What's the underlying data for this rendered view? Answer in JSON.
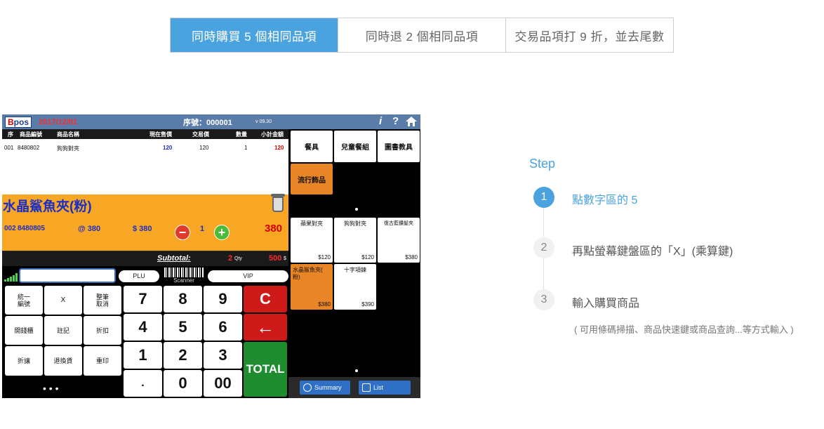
{
  "tabs": [
    {
      "label": "同時購買 5 個相同品項",
      "active": true
    },
    {
      "label": "同時退 2 個相同品項",
      "active": false
    },
    {
      "label": "交易品項打 9 折，並去尾數",
      "active": false
    }
  ],
  "pos": {
    "logo_b": "B",
    "logo_rest": "pos",
    "date": "2017/12/01",
    "seq": "序號：000001",
    "version": "v 09.30",
    "icons": {
      "info": "i",
      "help": "?",
      "home": "home-icon"
    },
    "headers": {
      "no": "序",
      "code": "商品編號",
      "name": "商品名稱",
      "price": "現在售價",
      "deal": "交易價",
      "qty": "數量",
      "subtotal": "小計金額"
    },
    "row": {
      "no": "001",
      "code": "8480802",
      "name": "狗狗對夾",
      "price": "120",
      "deal": "120",
      "qty": "1",
      "subtotal": "120"
    },
    "current": {
      "name": "水晶鯊魚夾(粉)",
      "seq": "002",
      "code": "8480805",
      "at": "@ 380",
      "amount": "$ 380",
      "minus": "−",
      "qty": "1",
      "plus": "+",
      "total": "380"
    },
    "subtotal": {
      "label": "Subtotal:",
      "qty": "2",
      "qty_unit": "Qty",
      "amount": "500",
      "amount_unit": "$"
    },
    "plu": "PLU",
    "scanner": "Scanner",
    "vip": "VIP",
    "fn_keys": [
      "統一\n編號",
      "X",
      "整筆\n取消",
      "開錢櫃",
      "註記",
      "折扣",
      "折讓",
      "退換貨",
      "重印"
    ],
    "num_keys": [
      "7",
      "8",
      "9",
      "4",
      "5",
      "6",
      "1",
      "2",
      "3",
      ".",
      "0",
      "00"
    ],
    "clear": "C",
    "back": "←",
    "total": "TOTAL",
    "dots": "•   •   •",
    "categories": [
      "餐具",
      "兒童餐組",
      "圖書教具",
      "流行飾品"
    ],
    "products": [
      {
        "name": "蘋果對夾",
        "price": "$120"
      },
      {
        "name": "狗狗對夾",
        "price": "$120"
      },
      {
        "name": "復古藍鑽髮夾",
        "price": "$380"
      },
      {
        "name": "水晶鯊魚夾(\n粉)",
        "price": "$380"
      },
      {
        "name": "十字項鍊",
        "price": "$390"
      }
    ],
    "summary": "Summary",
    "list": "List"
  },
  "steps": {
    "title": "Step",
    "items": [
      {
        "num": "1",
        "text": "點數字區的 5",
        "active": true
      },
      {
        "num": "2",
        "text": "再點螢幕鍵盤區的「X」(乘算鍵)",
        "active": false
      },
      {
        "num": "3",
        "text": "輸入購買商品",
        "active": false
      }
    ],
    "note": "( 可用條碼掃描、商品快速鍵或商品查詢...等方式輸入 )"
  },
  "colors": {
    "accent": "#4aa3df",
    "pos_header": "#5a7ca8",
    "item_panel": "#f7a723",
    "red_key": "#cf1a1a",
    "total_key": "#1f8c2f",
    "product_active": "#e88526"
  }
}
